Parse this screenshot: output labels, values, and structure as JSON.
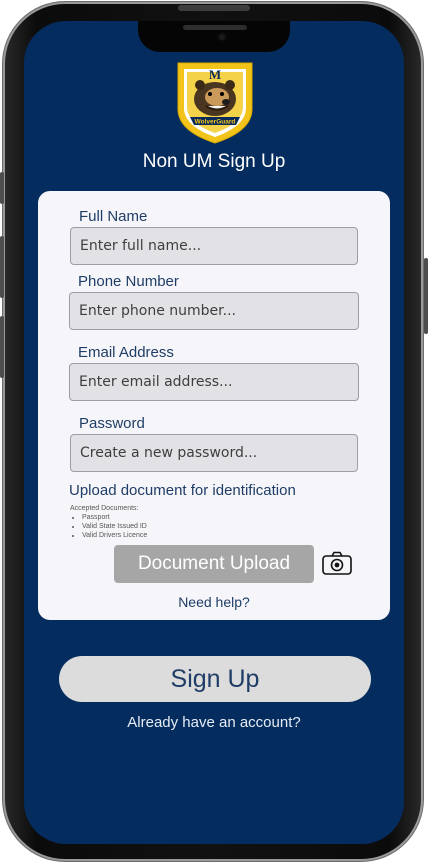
{
  "screen": {
    "title": "Non UM Sign Up",
    "logo_text": "WolverGuard",
    "background_color": "#042c5e"
  },
  "form": {
    "fields": [
      {
        "label": "Full Name",
        "placeholder": "Enter full name..."
      },
      {
        "label": "Phone Number",
        "placeholder": "Enter phone number..."
      },
      {
        "label": "Email Address",
        "placeholder": "Enter email address..."
      },
      {
        "label": "Password",
        "placeholder": "Create a new password..."
      }
    ],
    "upload": {
      "heading": "Upload document for identification",
      "accepted_title": "Accepted Documents:",
      "accepted_items": [
        "Passport",
        "Valid State Issued ID",
        "Valid Drivers Licence"
      ],
      "button_label": "Document Upload",
      "camera_icon": "camera-icon"
    },
    "help_link": "Need help?"
  },
  "actions": {
    "signup_label": "Sign Up",
    "login_link": "Already have an account?"
  }
}
